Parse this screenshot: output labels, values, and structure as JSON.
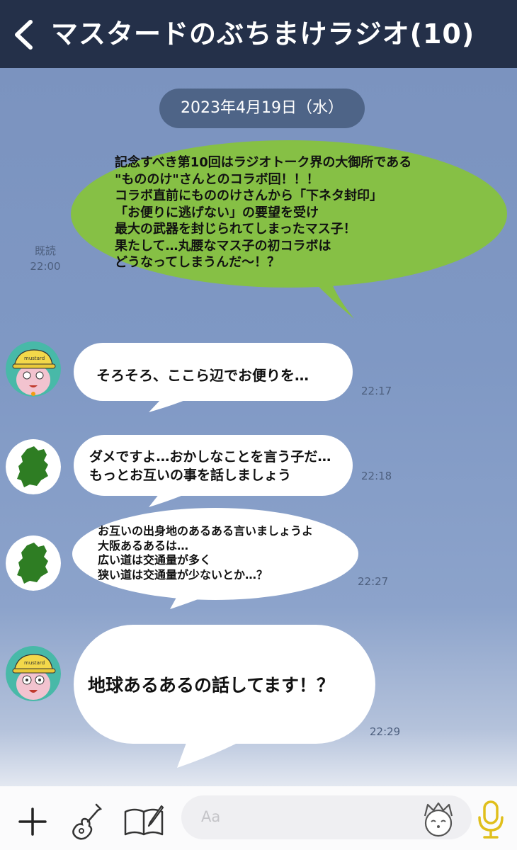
{
  "header": {
    "title": "マスタードのぶちまけラジオ(10)",
    "back_icon": "chevron-left-icon"
  },
  "date_label": "2023年4月19日（水）",
  "messages": [
    {
      "side": "sent",
      "lines": [
        "記念すべき第10回はラジオトーク界の大御所である",
        "\"もののけ\"さんとのコラボ回！！！",
        "コラボ直前にもののけさんから「下ネタ封印」",
        "「お便りに逃げない」の要望を受け",
        "最大の武器を封じられてしまったマス子！",
        "果たして…丸腰なマス子の初コラボは",
        "どうなってしまうんだ～！？"
      ],
      "read": "既読",
      "time": "22:00",
      "color": "#86c045"
    },
    {
      "side": "received",
      "avatar": "pink-mouse-avatar",
      "lines": [
        "そろそろ、ここら辺でお便りを…"
      ],
      "time": "22:17"
    },
    {
      "side": "received",
      "avatar": "osaka-map-avatar",
      "lines": [
        "ダメですよ…おかしなことを言う子だ…",
        "もっとお互いの事を話しましょう"
      ],
      "time": "22:18"
    },
    {
      "side": "received",
      "avatar": "osaka-map-avatar",
      "lines": [
        "お互いの出身地のあるある言いましょうよ",
        "大阪あるあるは…",
        "広い道は交通量が多く",
        "狭い道は交通量が少ないとか…？"
      ],
      "time": "22:27"
    },
    {
      "side": "received",
      "avatar": "pink-mouse-avatar",
      "lines": [
        "地球あるあるの話してます！？"
      ],
      "time": "22:29"
    }
  ],
  "avatar_cap_text": "mustard",
  "footer": {
    "placeholder": "Aa",
    "icons": [
      "plus-icon",
      "guitar-icon",
      "notebook-pen-icon",
      "mascot-sticker-icon",
      "microphone-icon"
    ],
    "mic_color": "#e0bf1c"
  },
  "colors": {
    "header": "#243049",
    "chat_bg": "#7d95c0",
    "sent_bubble": "#86c045",
    "received_bubble": "#ffffff",
    "avatar_bg": "#48b9a8",
    "map_green": "#2e7d23"
  }
}
